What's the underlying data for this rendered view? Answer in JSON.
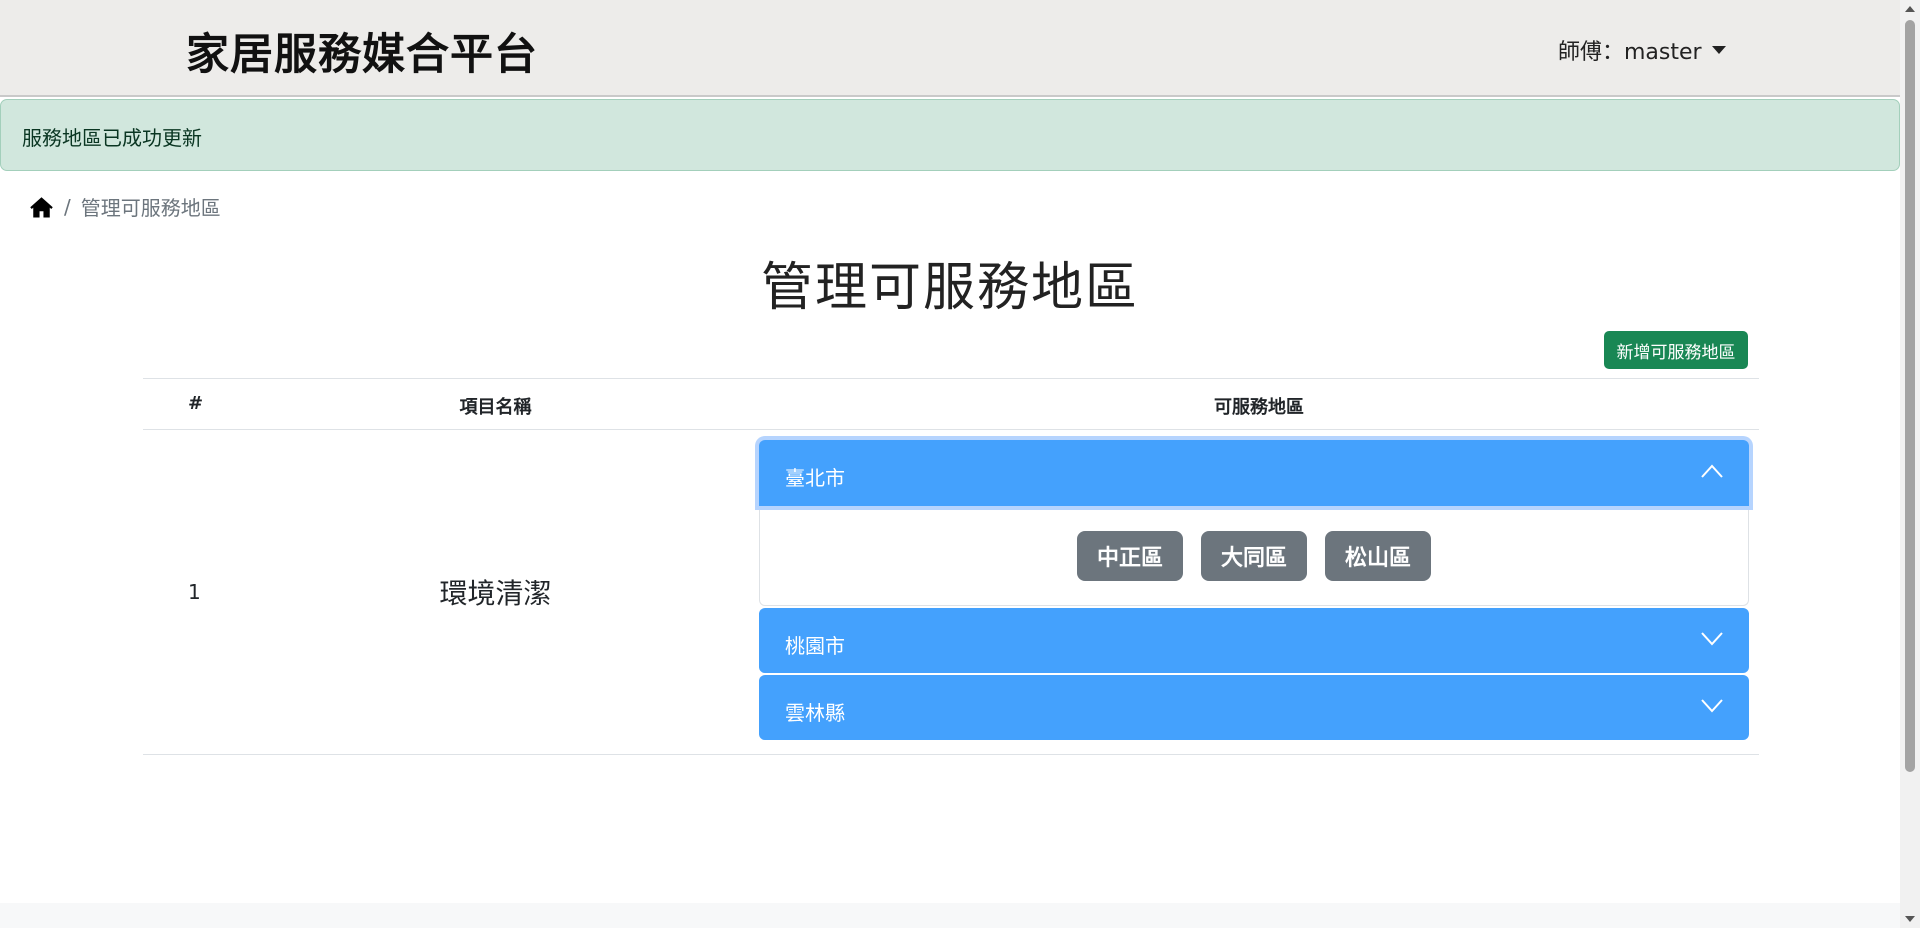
{
  "navbar": {
    "brand": "家居服務媒合平台",
    "user_label": "師傅：master"
  },
  "alert": {
    "message": "服務地區已成功更新"
  },
  "breadcrumb": {
    "current": "管理可服務地區"
  },
  "page": {
    "title": "管理可服務地區",
    "add_button": "新增可服務地區"
  },
  "table": {
    "headers": [
      "#",
      "項目名稱",
      "可服務地區"
    ],
    "rows": [
      {
        "index": "1",
        "name": "環境清潔",
        "cities": [
          {
            "name": "臺北市",
            "expanded": true,
            "districts": [
              "中正區",
              "大同區",
              "松山區"
            ]
          },
          {
            "name": "桃園市",
            "expanded": false
          },
          {
            "name": "雲林縣",
            "expanded": false
          }
        ]
      }
    ]
  },
  "colors": {
    "accordion_header": "#44a1fd",
    "district_button": "#6c757d",
    "add_button": "#198754",
    "alert_bg": "#d1e7dd"
  }
}
